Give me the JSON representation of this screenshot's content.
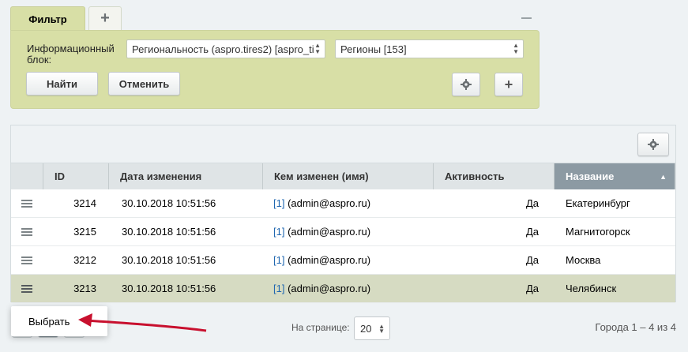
{
  "filter": {
    "tab_label": "Фильтр",
    "add_tab": "+",
    "field_label": "Информационный блок:",
    "iblock_select": "Региональность (aspro.tires2) [aspro_ti",
    "section_select": "Регионы [153]",
    "find_button": "Найти",
    "cancel_button": "Отменить",
    "add_button": "+"
  },
  "grid": {
    "columns": [
      "ID",
      "Дата изменения",
      "Кем изменен (имя)",
      "Активность",
      "Название"
    ],
    "sorted_column": "Название",
    "rows": [
      {
        "id": "3214",
        "date": "30.10.2018 10:51:56",
        "user_link": "[1]",
        "user": " (admin@aspro.ru)",
        "active": "Да",
        "name": "Екатеринбург"
      },
      {
        "id": "3215",
        "date": "30.10.2018 10:51:56",
        "user_link": "[1]",
        "user": " (admin@aspro.ru)",
        "active": "Да",
        "name": "Магнитогорск"
      },
      {
        "id": "3212",
        "date": "30.10.2018 10:51:56",
        "user_link": "[1]",
        "user": " (admin@aspro.ru)",
        "active": "Да",
        "name": "Москва"
      },
      {
        "id": "3213",
        "date": "30.10.2018 10:51:56",
        "user_link": "[1]",
        "user": " (admin@aspro.ru)",
        "active": "Да",
        "name": "Челябинск"
      }
    ]
  },
  "footer": {
    "per_page_label": "На странице:",
    "per_page_value": "20",
    "total": "Города 1 – 4 из 4"
  },
  "popup": {
    "select_label": "Выбрать"
  },
  "colors": {
    "filter_bg": "#d8dfa6",
    "selected_row": "#d6dbc2",
    "sorted_header": "#8c9aa3",
    "annotation_arrow": "#c8102e"
  }
}
